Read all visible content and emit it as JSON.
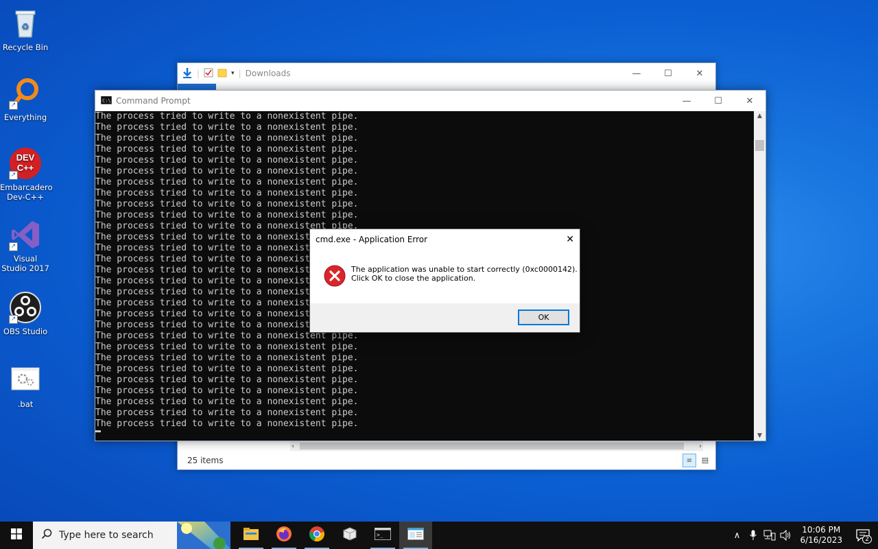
{
  "desktop": {
    "icons": [
      {
        "label": "Recycle Bin"
      },
      {
        "label": "Everything"
      },
      {
        "label": "Embarcadero Dev-C++"
      },
      {
        "label": "Visual Studio 2017"
      },
      {
        "label": "OBS Studio"
      },
      {
        "label": ".bat"
      }
    ]
  },
  "explorer": {
    "title": "Downloads",
    "status": "25 items"
  },
  "cmd": {
    "title": "Command Prompt",
    "line_text": "The process tried to write to a nonexistent pipe.",
    "line_count": 29
  },
  "dialog": {
    "title": "cmd.exe - Application Error",
    "message_line1": "The application was unable to start correctly (0xc0000142).",
    "message_line2": "Click OK to close the application.",
    "ok_label": "OK"
  },
  "taskbar": {
    "search_placeholder": "Type here to search",
    "apps": [
      "file-explorer",
      "firefox",
      "chrome",
      "package",
      "command-prompt",
      "notepad"
    ],
    "clock_time": "10:06 PM",
    "clock_date": "6/16/2023",
    "notification_count": "2"
  },
  "colors": {
    "desktop_blue": "#0b5fd2",
    "error_red": "#d9262a",
    "accent": "#0078d7"
  }
}
